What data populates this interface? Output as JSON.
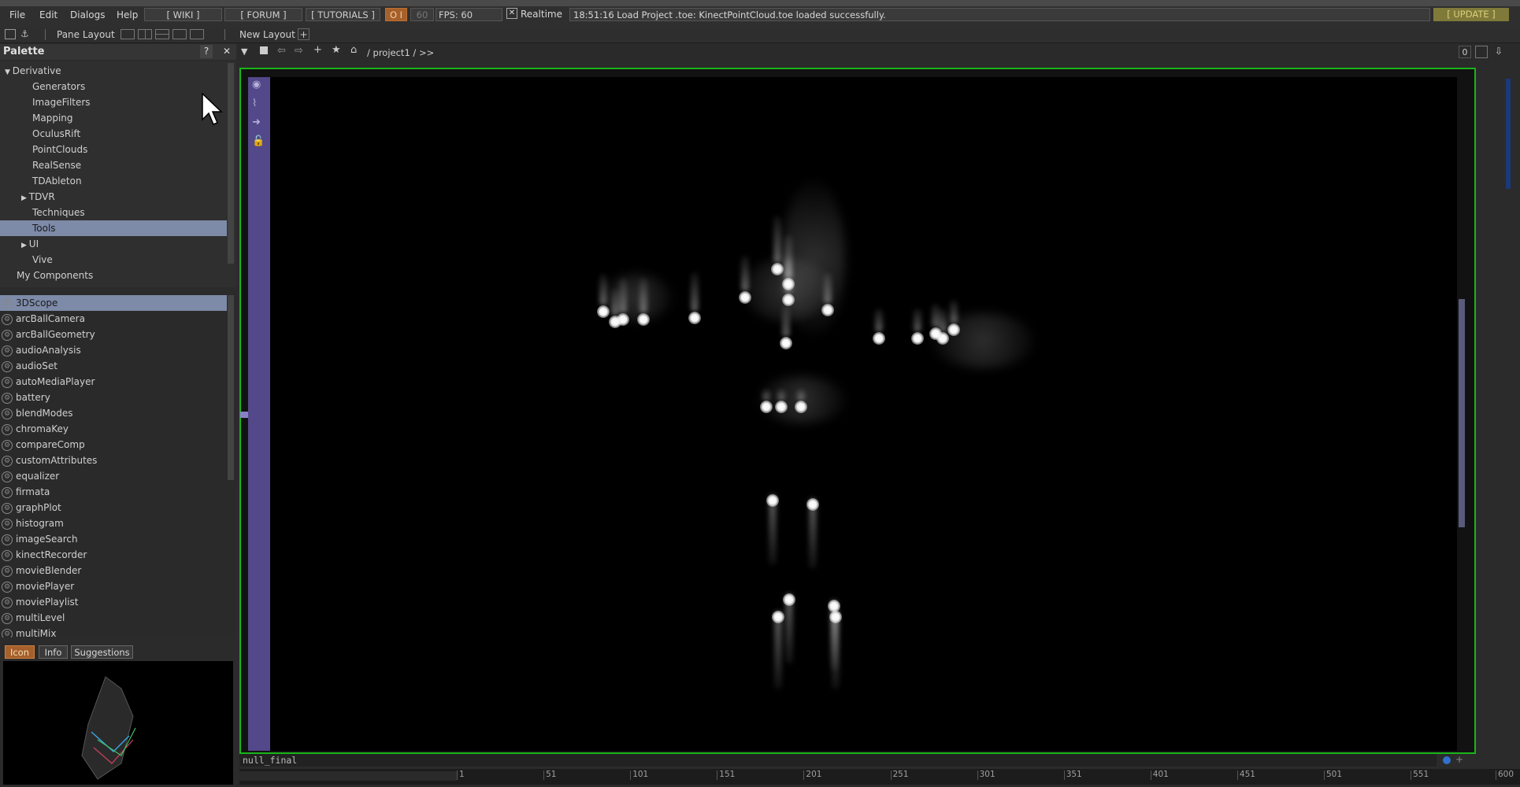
{
  "menu": [
    "File",
    "Edit",
    "Dialogs",
    "Help"
  ],
  "top_buttons": {
    "wiki": "[ WIKI ]",
    "forum": "[ FORUM ]",
    "tutorials": "[ TUTORIALS ]",
    "oi": "O I",
    "fps_cap": "60",
    "fps": "FPS: 60",
    "realtime": "Realtime",
    "update": "[ UPDATE ]"
  },
  "status_message": "18:51:16 Load Project .toe: KinectPointCloud.toe loaded successfully.",
  "layout_bar": {
    "pane_layout": "Pane Layout",
    "new_layout": "New Layout",
    "add": "+"
  },
  "palette": {
    "title": "Palette",
    "help": "?",
    "close": "✕",
    "tree": [
      {
        "label": "Derivative",
        "level": 0,
        "expanded": true
      },
      {
        "label": "Generators",
        "level": 2
      },
      {
        "label": "ImageFilters",
        "level": 2
      },
      {
        "label": "Mapping",
        "level": 2
      },
      {
        "label": "OculusRift",
        "level": 2
      },
      {
        "label": "PointClouds",
        "level": 2
      },
      {
        "label": "RealSense",
        "level": 2
      },
      {
        "label": "TDAbleton",
        "level": 2
      },
      {
        "label": "TDVR",
        "level": 2,
        "collapsed": true
      },
      {
        "label": "Techniques",
        "level": 2
      },
      {
        "label": "Tools",
        "level": 2,
        "selected": true
      },
      {
        "label": "UI",
        "level": 2,
        "collapsed": true
      },
      {
        "label": "Vive",
        "level": 2
      },
      {
        "label": "My Components",
        "level": 1
      }
    ],
    "components": [
      "3DScope",
      "arcBallCamera",
      "arcBallGeometry",
      "audioAnalysis",
      "audioSet",
      "autoMediaPlayer",
      "battery",
      "blendModes",
      "chromaKey",
      "compareComp",
      "customAttributes",
      "equalizer",
      "firmata",
      "graphPlot",
      "histogram",
      "imageSearch",
      "kinectRecorder",
      "movieBlender",
      "moviePlayer",
      "moviePlaylist",
      "multiLevel",
      "multiMix"
    ],
    "selected_component": "3DScope",
    "tabs": [
      "Icon",
      "Info",
      "Suggestions"
    ],
    "active_tab": "Icon"
  },
  "network": {
    "path": "/ project1 / >>",
    "right_value": "0"
  },
  "viewer": {
    "node_name": "null_final"
  },
  "timeline": {
    "ticks": [
      "1",
      "51",
      "101",
      "151",
      "201",
      "251",
      "301",
      "351",
      "401",
      "451",
      "501",
      "551",
      "600"
    ]
  }
}
